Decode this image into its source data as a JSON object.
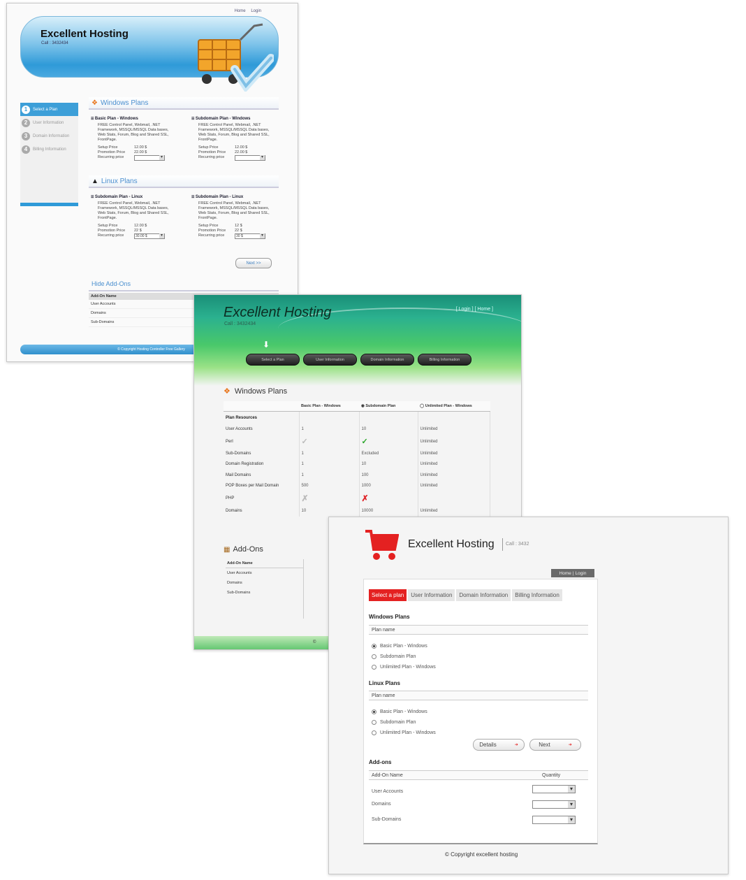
{
  "blue_site": {
    "top_links": [
      "Home",
      "Login"
    ],
    "brand": "Excellent Hosting",
    "call": "Call : 3432434",
    "steps": [
      "Select a Plan",
      "User Information",
      "Domain Information",
      "Billing Information"
    ],
    "windows_section": "Windows Plans",
    "linux_section": "Linux Plans",
    "plan_desc": "FREE Control Panel, Webmail, .NET Framework, MSSQL/MSSQL Data bases, Web Stats, Forum, Blog and Shared SSL, FrontPage.",
    "linux_desc": "FREE Control Panel, Webmail, .NET Framework, MSSQL/MSSQL Data bases, Web Stats, Forum, Blog and Shared SSL, FrontPage.",
    "labels": {
      "setup": "Setup Price",
      "promo": "Promotion Price",
      "recurring": "Recurring price"
    },
    "windows_plans": [
      {
        "name": "Basic Plan - Windows",
        "setup": "12.00 $",
        "promo": "22.00 $",
        "recurring": ""
      },
      {
        "name": "Subdomain Plan - Windows",
        "setup": "12.00 $",
        "promo": "22.00 $",
        "recurring": ""
      }
    ],
    "linux_plans": [
      {
        "name": "Subdomain Plan - Linux",
        "setup": "12.00 $",
        "promo": "22 $",
        "recurring": "30.00 $"
      },
      {
        "name": "Subdomain Plan - Linux",
        "setup": "12 $",
        "promo": "22 $",
        "recurring": "30 $"
      }
    ],
    "next": "Next >>",
    "addons_toggle": "Hide Add-Ons",
    "addons_header": "Add-On Name",
    "addons": [
      "User Accounts",
      "Domains",
      "Sub-Domains"
    ],
    "footer": "© Copyright Hosting Controller Free Gallery"
  },
  "green_site": {
    "brand": "Excellent Hosting",
    "call": "Call : 3432434",
    "top_links": "[ Login ] [ Home ]",
    "steps": [
      "Select a Plan",
      "User Information",
      "Domain Information",
      "Billing Information"
    ],
    "windows_section": "Windows Plans",
    "columns": [
      "Basic Plan - Windows",
      "Subdomain Plan",
      "Unlimited Plan - Windows"
    ],
    "section_row": "Plan Resources",
    "rows": [
      {
        "label": "User Accounts",
        "c1": "1",
        "c2": "10",
        "c3": "Unlimited"
      },
      {
        "label": "Perl",
        "c1": "check-light",
        "c2": "check",
        "c3": "Unlimited"
      },
      {
        "label": "Sub-Domains",
        "c1": "1",
        "c2": "Excluded",
        "c3": "Unlimited"
      },
      {
        "label": "Domain Registration",
        "c1": "1",
        "c2": "10",
        "c3": "Unlimited"
      },
      {
        "label": "Mail Domains",
        "c1": "1",
        "c2": "100",
        "c3": "Unlimited"
      },
      {
        "label": "POP Boxes per Mail Domain",
        "c1": "500",
        "c2": "1000",
        "c3": "Unlimited"
      },
      {
        "label": "PHP",
        "c1": "cross-light",
        "c2": "cross",
        "c3": ""
      },
      {
        "label": "Domains",
        "c1": "10",
        "c2": "10000",
        "c3": "Unlimited"
      }
    ],
    "addons_title": "Add-Ons",
    "addons_header": "Add-On Name",
    "addons": [
      "User Accounts",
      "Domains",
      "Sub-Domains"
    ],
    "footer": "©"
  },
  "red_site": {
    "brand": "Excellent Hosting",
    "call": "Call : 3432",
    "top_links": [
      "Home",
      "Login"
    ],
    "tabs": [
      "Select a plan",
      "User Information",
      "Domain Information",
      "Billing Information"
    ],
    "windows_section": "Windows Plans",
    "linux_section": "Linux Plans",
    "plan_name_header": "Plan name",
    "windows_options": [
      "Basic Plan - Windows",
      "Subdomain Plan",
      "Unlimited Plan - Windows"
    ],
    "linux_options": [
      "Basic Plan - Windows",
      "Subdomain Plan",
      "Unlimited Plan - Windows"
    ],
    "details_button": "Details",
    "next_button": "Next",
    "addons_section": "Add-ons",
    "addon_name_header": "Add-On Name",
    "quantity_header": "Quantity",
    "addons": [
      "User Accounts",
      "Domains",
      "Sub-Domains"
    ],
    "copyright": "© Copyright excellent hosting"
  }
}
